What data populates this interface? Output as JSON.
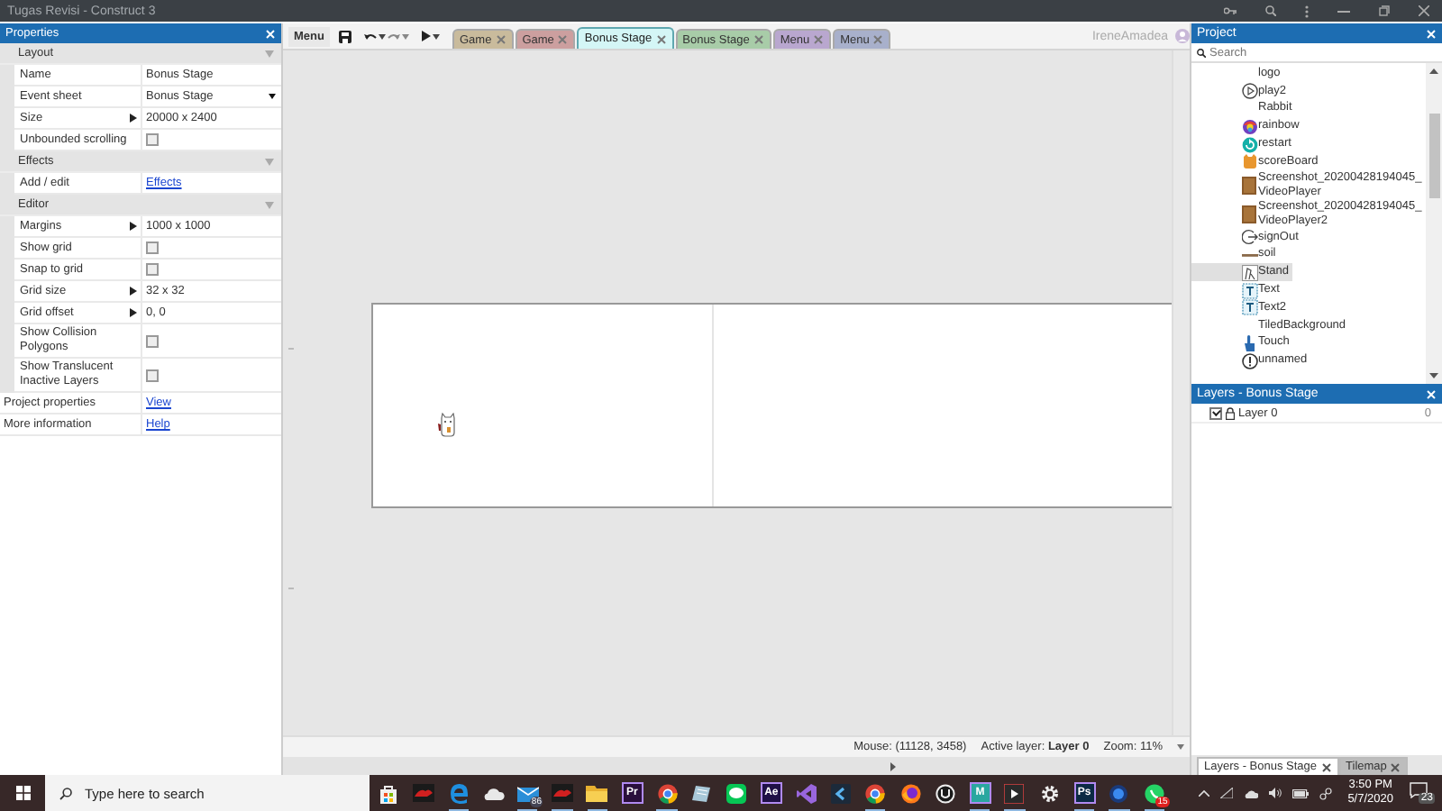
{
  "window": {
    "title": "Tugas Revisi - Construct 3"
  },
  "properties": {
    "title": "Properties",
    "sections": [
      {
        "name": "Layout",
        "rows": [
          {
            "label": "Name",
            "kind": "text",
            "value": "Bonus Stage"
          },
          {
            "label": "Event sheet",
            "kind": "dropdown",
            "value": "Bonus Stage"
          },
          {
            "label": "Size",
            "kind": "expand",
            "value": "20000 x 2400"
          },
          {
            "label": "Unbounded scrolling",
            "kind": "checkbox",
            "checked": false
          }
        ]
      },
      {
        "name": "Effects",
        "rows": [
          {
            "label": "Add / edit",
            "kind": "link",
            "value": "Effects"
          }
        ]
      },
      {
        "name": "Editor",
        "rows": [
          {
            "label": "Margins",
            "kind": "expand",
            "value": "1000 x 1000"
          },
          {
            "label": "Show grid",
            "kind": "checkbox",
            "checked": false
          },
          {
            "label": "Snap to grid",
            "kind": "checkbox",
            "checked": false
          },
          {
            "label": "Grid size",
            "kind": "expand",
            "value": "32 x 32"
          },
          {
            "label": "Grid offset",
            "kind": "expand",
            "value": "0, 0"
          },
          {
            "label": "Show Collision Polygons",
            "kind": "checkbox",
            "checked": false
          },
          {
            "label": "Show Translucent Inactive Layers",
            "kind": "checkbox",
            "checked": false
          }
        ]
      }
    ],
    "footer": [
      {
        "label": "Project properties",
        "kind": "link",
        "value": "View"
      },
      {
        "label": "More information",
        "kind": "link",
        "value": "Help"
      }
    ]
  },
  "toolbar": {
    "menu": "Menu",
    "tabs": [
      {
        "label": "Game",
        "color": "#c9bb9c",
        "selected": false
      },
      {
        "label": "Game",
        "color": "#cc9f9f",
        "selected": false
      },
      {
        "label": "Bonus Stage",
        "color": "#d4f6f6",
        "selected": true
      },
      {
        "label": "Bonus Stage",
        "color": "#a8cca8",
        "selected": false
      },
      {
        "label": "Menu",
        "color": "#b9a7cf",
        "selected": false
      },
      {
        "label": "Menu",
        "color": "#a8b0cb",
        "selected": false
      }
    ],
    "user": "IreneAmadea"
  },
  "layout_view": {
    "status": {
      "mouse": "Mouse: (11128, 3458)",
      "active_layer": "Active layer: **Layer 0**",
      "zoom": "Zoom: 11%"
    }
  },
  "project": {
    "title": "Project",
    "search": {
      "placeholder": "Search"
    },
    "items": [
      {
        "label": "logo",
        "kind": "none",
        "selected": false
      },
      {
        "label": "play2",
        "kind": "play",
        "selected": false
      },
      {
        "label": "Rabbit",
        "kind": "none",
        "selected": false
      },
      {
        "label": "rainbow",
        "kind": "rainbow",
        "selected": false
      },
      {
        "label": "restart",
        "kind": "restart",
        "selected": false
      },
      {
        "label": "scoreBoard",
        "kind": "face",
        "selected": false
      },
      {
        "label": "Screenshot_20200428194045_VideoPlayer",
        "kind": "video",
        "selected": false
      },
      {
        "label": "Screenshot_20200428194045_VideoPlayer2",
        "kind": "video",
        "selected": false
      },
      {
        "label": "signOut",
        "kind": "signout",
        "selected": false
      },
      {
        "label": "soil",
        "kind": "line",
        "selected": false
      },
      {
        "label": "Stand",
        "kind": "sprite",
        "selected": true
      },
      {
        "label": "Text",
        "kind": "text",
        "selected": false
      },
      {
        "label": "Text2",
        "kind": "text",
        "selected": false
      },
      {
        "label": "TiledBackground",
        "kind": "none",
        "selected": false
      },
      {
        "label": "Touch",
        "kind": "touch",
        "selected": false
      },
      {
        "label": "unnamed",
        "kind": "info",
        "selected": false
      }
    ]
  },
  "layers": {
    "title": "Layers - Bonus Stage",
    "rows": [
      {
        "name": "Layer 0",
        "value": "0",
        "visible": true
      }
    ]
  },
  "dock_tabs": [
    {
      "label": "Layers - Bonus Stage",
      "selected": true
    },
    {
      "label": "Tilemap",
      "selected": false
    }
  ],
  "taskbar": {
    "search": {
      "placeholder": "Type here to search"
    },
    "apps": [
      {
        "kind": "store",
        "running": false
      },
      {
        "kind": "game",
        "running": false
      },
      {
        "kind": "edge",
        "running": true
      },
      {
        "kind": "cloud",
        "running": false
      },
      {
        "kind": "mail",
        "badge": "86",
        "running": true
      },
      {
        "kind": "game",
        "running": true
      },
      {
        "kind": "folder",
        "running": true
      },
      {
        "kind": "tile",
        "label": "Pr",
        "color": "#2a0f3c",
        "running": false
      },
      {
        "kind": "chrome",
        "running": true
      },
      {
        "kind": "notes",
        "running": false
      },
      {
        "kind": "chat",
        "running": false
      },
      {
        "kind": "tile",
        "label": "Ae",
        "color": "#1f1046",
        "running": false
      },
      {
        "kind": "vs",
        "running": false
      },
      {
        "kind": "arrow",
        "running": false
      },
      {
        "kind": "chrome",
        "running": true
      },
      {
        "kind": "firefox",
        "running": false
      },
      {
        "kind": "unreal",
        "running": false
      },
      {
        "kind": "tile",
        "label": "M",
        "color": "#2aa7a0",
        "running": true
      },
      {
        "kind": "player",
        "running": true
      },
      {
        "kind": "gear",
        "running": false
      },
      {
        "kind": "tile",
        "label": "Ps",
        "color": "#0b2a44",
        "running": true
      },
      {
        "kind": "circle",
        "running": true
      },
      {
        "kind": "whatsapp",
        "badge": "15",
        "running": true
      }
    ],
    "time": "3:50 PM",
    "date": "5/7/2020",
    "notifications": "23"
  }
}
